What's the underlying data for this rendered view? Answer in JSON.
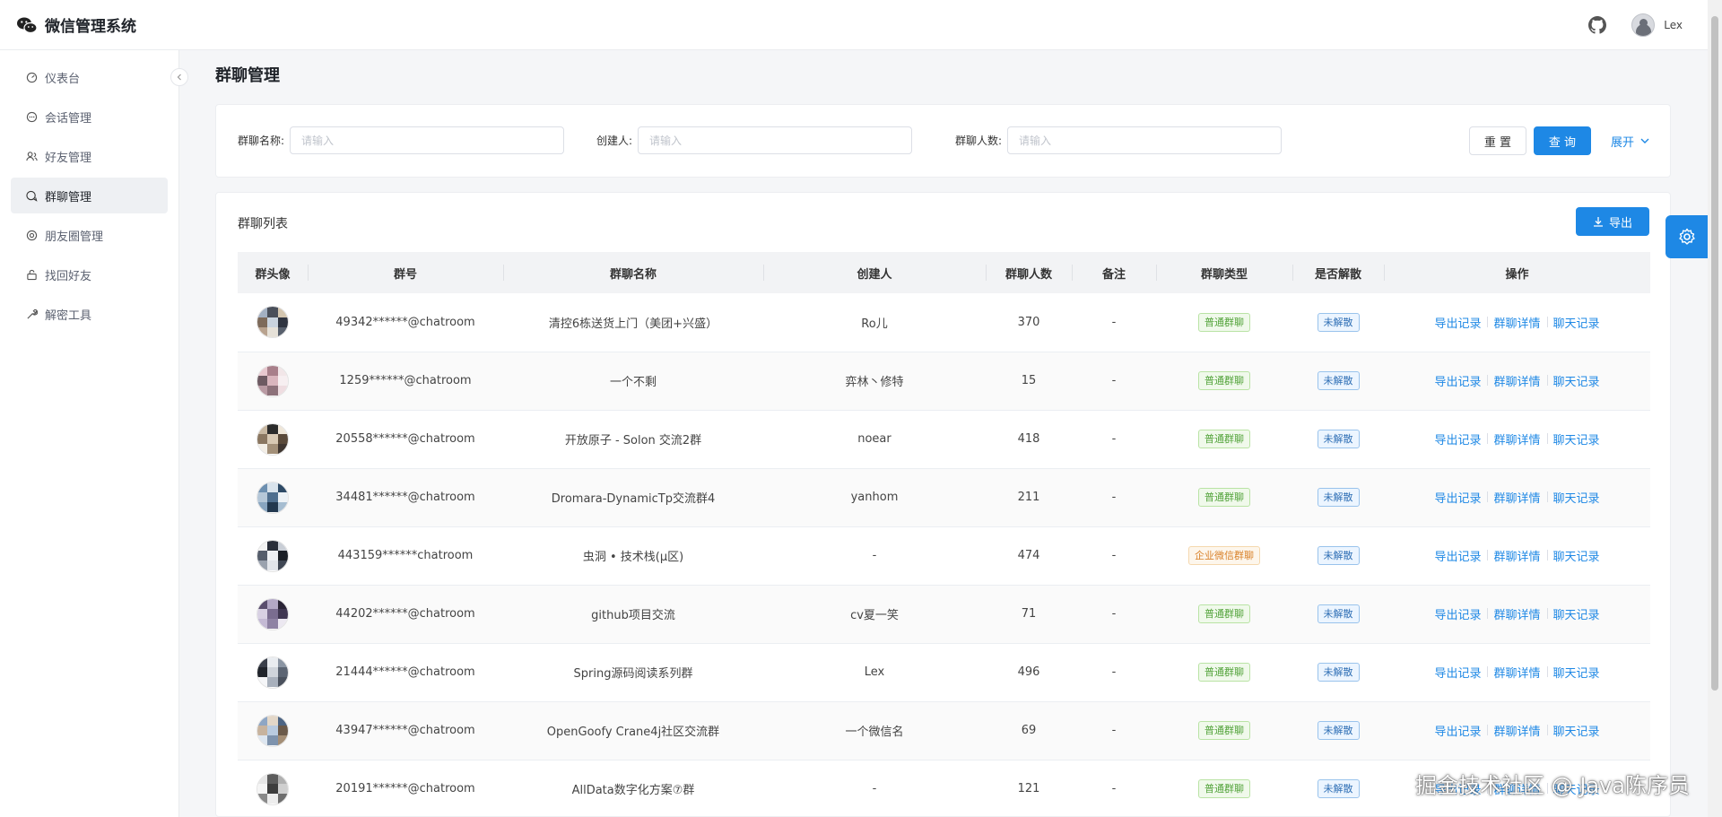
{
  "app": {
    "title": "微信管理系统"
  },
  "user": {
    "name": "Lex"
  },
  "sidebar": {
    "items": [
      {
        "label": "仪表台",
        "icon": "dashboard-icon"
      },
      {
        "label": "会话管理",
        "icon": "chat-icon"
      },
      {
        "label": "好友管理",
        "icon": "friends-icon"
      },
      {
        "label": "群聊管理",
        "icon": "group-chat-icon",
        "active": true
      },
      {
        "label": "朋友圈管理",
        "icon": "moments-icon"
      },
      {
        "label": "找回好友",
        "icon": "recover-icon"
      },
      {
        "label": "解密工具",
        "icon": "tool-icon"
      }
    ]
  },
  "page": {
    "title": "群聊管理"
  },
  "search": {
    "name_label": "群聊名称:",
    "name_placeholder": "请输入",
    "creator_label": "创建人:",
    "creator_placeholder": "请输入",
    "count_label": "群聊人数:",
    "count_placeholder": "请输入",
    "reset_label": "重 置",
    "query_label": "查 询",
    "expand_label": "展开"
  },
  "table": {
    "caption": "群聊列表",
    "export_label": "导出",
    "columns": [
      "群头像",
      "群号",
      "群聊名称",
      "创建人",
      "群聊人数",
      "备注",
      "群聊类型",
      "是否解散",
      "操作"
    ],
    "actions": [
      "导出记录",
      "群聊详情",
      "聊天记录"
    ],
    "rows": [
      {
        "id": "49342******@chatroom",
        "name": "清控6栋送货上门（美团+兴盛）",
        "creator": "Ro儿",
        "count": "370",
        "remark": "-",
        "type": "普通群聊",
        "type_style": "green",
        "status": "未解散"
      },
      {
        "id": "1259******@chatroom",
        "name": "一个不剩",
        "creator": "弈林丶修特",
        "count": "15",
        "remark": "-",
        "type": "普通群聊",
        "type_style": "green",
        "status": "未解散"
      },
      {
        "id": "20558******@chatroom",
        "name": "开放原子 - Solon 交流2群",
        "creator": "noear",
        "count": "418",
        "remark": "-",
        "type": "普通群聊",
        "type_style": "green",
        "status": "未解散"
      },
      {
        "id": "34481******@chatroom",
        "name": "Dromara-DynamicTp交流群4",
        "creator": "yanhom",
        "count": "211",
        "remark": "-",
        "type": "普通群聊",
        "type_style": "green",
        "status": "未解散"
      },
      {
        "id": "443159******chatroom",
        "name": "虫洞 • 技术栈(μ区)",
        "creator": "-",
        "count": "474",
        "remark": "-",
        "type": "企业微信群聊",
        "type_style": "orange",
        "status": "未解散"
      },
      {
        "id": "44202******@chatroom",
        "name": "github项目交流",
        "creator": "cv夏一笑",
        "count": "71",
        "remark": "-",
        "type": "普通群聊",
        "type_style": "green",
        "status": "未解散"
      },
      {
        "id": "21444******@chatroom",
        "name": "Spring源码阅读系列群",
        "creator": "Lex",
        "count": "496",
        "remark": "-",
        "type": "普通群聊",
        "type_style": "green",
        "status": "未解散"
      },
      {
        "id": "43947******@chatroom",
        "name": "OpenGoofy Crane4j社区交流群",
        "creator": "一个微信名",
        "count": "69",
        "remark": "-",
        "type": "普通群聊",
        "type_style": "green",
        "status": "未解散"
      },
      {
        "id": "20191******@chatroom",
        "name": "AllData数字化方案⑦群",
        "creator": "-",
        "count": "121",
        "remark": "-",
        "type": "普通群聊",
        "type_style": "green",
        "status": "未解散"
      }
    ]
  },
  "watermark": "掘金技术社区 @ Java陈序员",
  "colors": {
    "primary": "#1e88e5",
    "tag_green": "#52a33a",
    "tag_orange": "#d9822b",
    "tag_blue": "#2f6fb5"
  }
}
